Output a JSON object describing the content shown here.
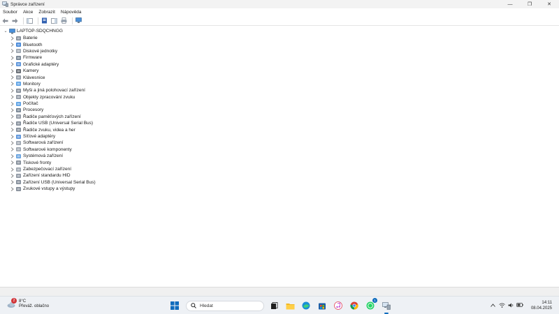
{
  "window": {
    "title": "Správce zařízení",
    "controls": {
      "minimize": "—",
      "maximize": "❐",
      "close": "✕"
    }
  },
  "menu": [
    "Soubor",
    "Akce",
    "Zobrazit",
    "Nápověda"
  ],
  "tree": {
    "root_label": "LAPTOP-SDQCHNGG",
    "categories": [
      {
        "label": "Baterie",
        "icon": "battery-icon"
      },
      {
        "label": "Bluetooth",
        "icon": "bluetooth-icon"
      },
      {
        "label": "Diskové jednotky",
        "icon": "disk-drive-icon"
      },
      {
        "label": "Firmware",
        "icon": "firmware-icon"
      },
      {
        "label": "Grafické adaptéry",
        "icon": "display-adapter-icon"
      },
      {
        "label": "Kamery",
        "icon": "camera-icon"
      },
      {
        "label": "Klávesnice",
        "icon": "keyboard-icon"
      },
      {
        "label": "Monitory",
        "icon": "monitor-icon"
      },
      {
        "label": "Myši a jiná polohovací zařízení",
        "icon": "mouse-icon"
      },
      {
        "label": "Objekty zpracování zvuku",
        "icon": "audio-processing-icon"
      },
      {
        "label": "Počítač",
        "icon": "computer-icon"
      },
      {
        "label": "Procesory",
        "icon": "processor-icon"
      },
      {
        "label": "Řadiče paměťových zařízení",
        "icon": "storage-controller-icon"
      },
      {
        "label": "Řadiče USB (Universal Serial Bus)",
        "icon": "usb-controller-icon"
      },
      {
        "label": "Řadiče zvuku, videa a her",
        "icon": "sound-controller-icon"
      },
      {
        "label": "Síťové adaptéry",
        "icon": "network-adapter-icon"
      },
      {
        "label": "Softwarová zařízení",
        "icon": "software-device-icon"
      },
      {
        "label": "Softwarové komponenty",
        "icon": "software-component-icon"
      },
      {
        "label": "Systémová zařízení",
        "icon": "system-device-icon"
      },
      {
        "label": "Tiskové fronty",
        "icon": "print-queue-icon"
      },
      {
        "label": "Zabezpečovací zařízení",
        "icon": "security-device-icon"
      },
      {
        "label": "Zařízení standardu HID",
        "icon": "hid-icon"
      },
      {
        "label": "Zařízení USB (Universal Serial Bus)",
        "icon": "usb-device-icon"
      },
      {
        "label": "Zvukové vstupy a výstupy",
        "icon": "audio-io-icon"
      }
    ]
  },
  "taskbar": {
    "weather": {
      "temp": "8°C",
      "desc": "Převáž. oblačno",
      "badge": "2"
    },
    "search_placeholder": "Hledat",
    "whatsapp_badge": "1",
    "clock": {
      "time": "14:11",
      "date": "08.04.2025"
    }
  },
  "colors": {
    "accent": "#0f6cbd",
    "taskbar": "#eef1f5"
  }
}
